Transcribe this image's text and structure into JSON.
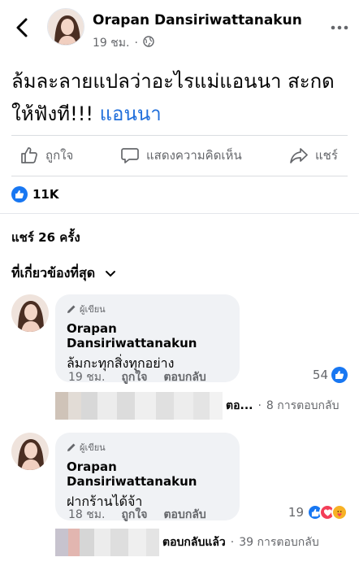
{
  "header": {
    "name": "Orapan Dansiriwattanakun",
    "time": "19 ชม.",
    "dot": "·"
  },
  "post": {
    "text": "ล้มละลายแปลว่าอะไรแม่แอนนา สะกด ให้ฟังที!!!",
    "tag": "แอนนา"
  },
  "actions": {
    "like": "ถูกใจ",
    "comment": "แสดงความคิดเห็น",
    "share": "แชร์"
  },
  "reactions": {
    "count": "11K"
  },
  "shares": {
    "label": "แชร์ 26 ครั้ง"
  },
  "filter": {
    "label": "ที่เกี่ยวข้องที่สุด"
  },
  "comments": [
    {
      "badge": "ผู้เขียน",
      "name": "Orapan Dansiriwattanakun",
      "text": "ล้มกะทุกสิ่งทุกอย่าง",
      "time": "19 ชม.",
      "like": "ถูกใจ",
      "reply": "ตอบกลับ",
      "reaction_count": "54",
      "replies": {
        "truncated": "ตอ...",
        "dot": "·",
        "count": "8 การตอบกลับ"
      }
    },
    {
      "badge": "ผู้เขียน",
      "name": "Orapan Dansiriwattanakun",
      "text": "ฝากร้านได้จ้า",
      "time": "18 ชม.",
      "like": "ถูกใจ",
      "reply": "ตอบกลับ",
      "reaction_count": "19",
      "replies": {
        "truncated": "ตอบกลับแล้ว",
        "dot": "·",
        "count": "39 การตอบกลับ"
      }
    }
  ],
  "colors": {
    "link": "#216fdb",
    "like_blue": "#1877f2",
    "love_red": "#f33e58",
    "haha_yellow": "#f7b125"
  }
}
